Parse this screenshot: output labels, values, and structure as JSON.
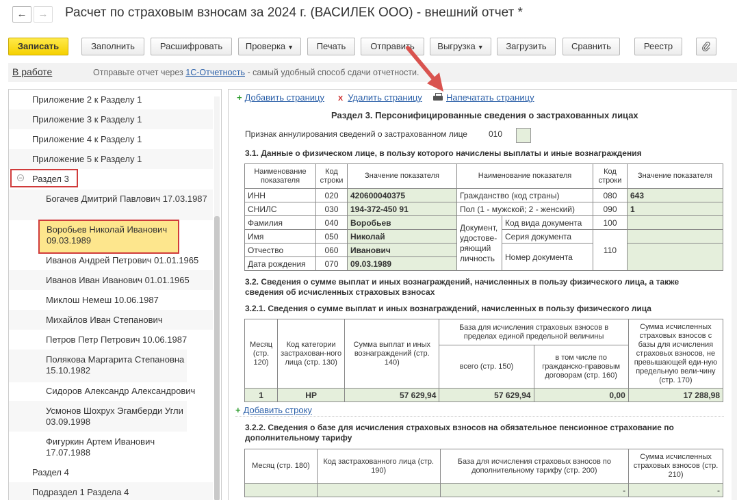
{
  "window": {
    "title": "Расчет по страховым взносам за 2024 г. (ВАСИЛЕК ООО) - внешний отчет *",
    "back_icon": "arrow-left-icon",
    "forward_icon": "arrow-right-icon"
  },
  "toolbar": {
    "save": "Записать",
    "fill": "Заполнить",
    "decode": "Расшифровать",
    "check": "Проверка",
    "print": "Печать",
    "send": "Отправить",
    "export": "Выгрузка",
    "load": "Загрузить",
    "compare": "Сравнить",
    "registry": "Реестр",
    "attach_icon": "paperclip-icon"
  },
  "status": {
    "state": "В работе",
    "hint_prefix": "Отправьте отчет через ",
    "hint_link": "1С-Отчетность",
    "hint_suffix": " - самый удобный способ сдачи отчетности."
  },
  "tree": {
    "items": [
      "Приложение 2 к Разделу 1",
      "Приложение 3 к Разделу 1",
      "Приложение 4 к Разделу 1",
      "Приложение 5 к Разделу 1",
      "Раздел 3",
      "Богачев Дмитрий Павлович 17.03.1987",
      "Воробьев Николай Иванович 09.03.1989",
      "Иванов Андрей Петрович 01.01.1965",
      "Иванов Иван Иванович 01.01.1965",
      "Миклош Немеш 10.06.1987",
      "Михайлов Иван Степанович",
      "Петров Петр Петрович 10.06.1987",
      "Полякова Маргарита Степановна 15.10.1982",
      "Сидоров Александр Александрович",
      "Усмонов Шохрух Эгамберди Угли 03.09.1998",
      "Фигуркин Артем Иванович 17.07.1988",
      "Раздел 4",
      "Подраздел 1 Раздела 4"
    ]
  },
  "actions": {
    "add_page": "Добавить страницу",
    "delete_page": "Удалить страницу",
    "print_page": "Напечатать страницу",
    "add_row": "Добавить строку"
  },
  "form": {
    "section_title": "Раздел 3. Персонифицированные сведения о застрахованных лицах",
    "annul_label": "Признак аннулирования сведений о застрахованном лице",
    "annul_code": "010",
    "h31": "3.1. Данные о физическом лице, в пользу которого начислены выплаты и иные вознаграждения",
    "t1_headers": [
      "Наименование показателя",
      "Код строки",
      "Значение показателя",
      "Наименование показателя",
      "Код строки",
      "Значение показателя"
    ],
    "t1_rows": [
      [
        "ИНН",
        "020",
        "420600040375",
        "Гражданство (код страны)",
        "080",
        "643"
      ],
      [
        "СНИЛС",
        "030",
        "194-372-450 91",
        "Пол (1 - мужской; 2 - женский)",
        "090",
        "1"
      ],
      [
        "Фамилия",
        "040",
        "Воробьев"
      ],
      [
        "Имя",
        "050",
        "Николай"
      ],
      [
        "Отчество",
        "060",
        "Иванович"
      ],
      [
        "Дата рождения",
        "070",
        "09.03.1989"
      ]
    ],
    "doc_label": "Документ, удостове-ряющий личность",
    "doc_rows": [
      [
        "Код вида документа",
        "100"
      ],
      [
        "Серия документа",
        "110"
      ],
      [
        "Номер документа",
        ""
      ]
    ],
    "h32": "3.2. Сведения о сумме выплат и иных вознаграждений, начисленных в пользу физического лица, а также сведения об исчисленных страховых взносах",
    "h321": "3.2.1. Сведения о сумме выплат и иных вознаграждений, начисленных в пользу физического лица",
    "t2_headers": {
      "month": "Месяц (стр. 120)",
      "category": "Код категории застрахован-ного лица (стр. 130)",
      "sum": "Сумма выплат и иных вознаграждений (стр. 140)",
      "base": "База для исчисления страховых взносов в пределах единой предельной величины",
      "total": "всего (стр. 150)",
      "civil": "в том числе по гражданско-правовым договорам (стр. 160)",
      "calc": "Сумма исчисленных страховых взносов с базы для исчисления страховых взносов, не превышающей еди-ную предельную вели-чину (стр. 170)"
    },
    "t2_row": [
      "1",
      "НР",
      "57 629,94",
      "57 629,94",
      "0,00",
      "17 288,98"
    ],
    "h322": "3.2.2. Сведения о базе для исчисления страховых взносов на обязательное пенсионное страхование по дополнительному тарифу",
    "t3_headers": [
      "Месяц (стр. 180)",
      "Код застрахованного лица (стр. 190)",
      "База для исчисления страховых взносов по дополнительному тарифу (стр. 200)",
      "Сумма исчисленных страховых взносов (стр. 210)"
    ],
    "t3_row": [
      "",
      "",
      "-",
      "-"
    ]
  }
}
